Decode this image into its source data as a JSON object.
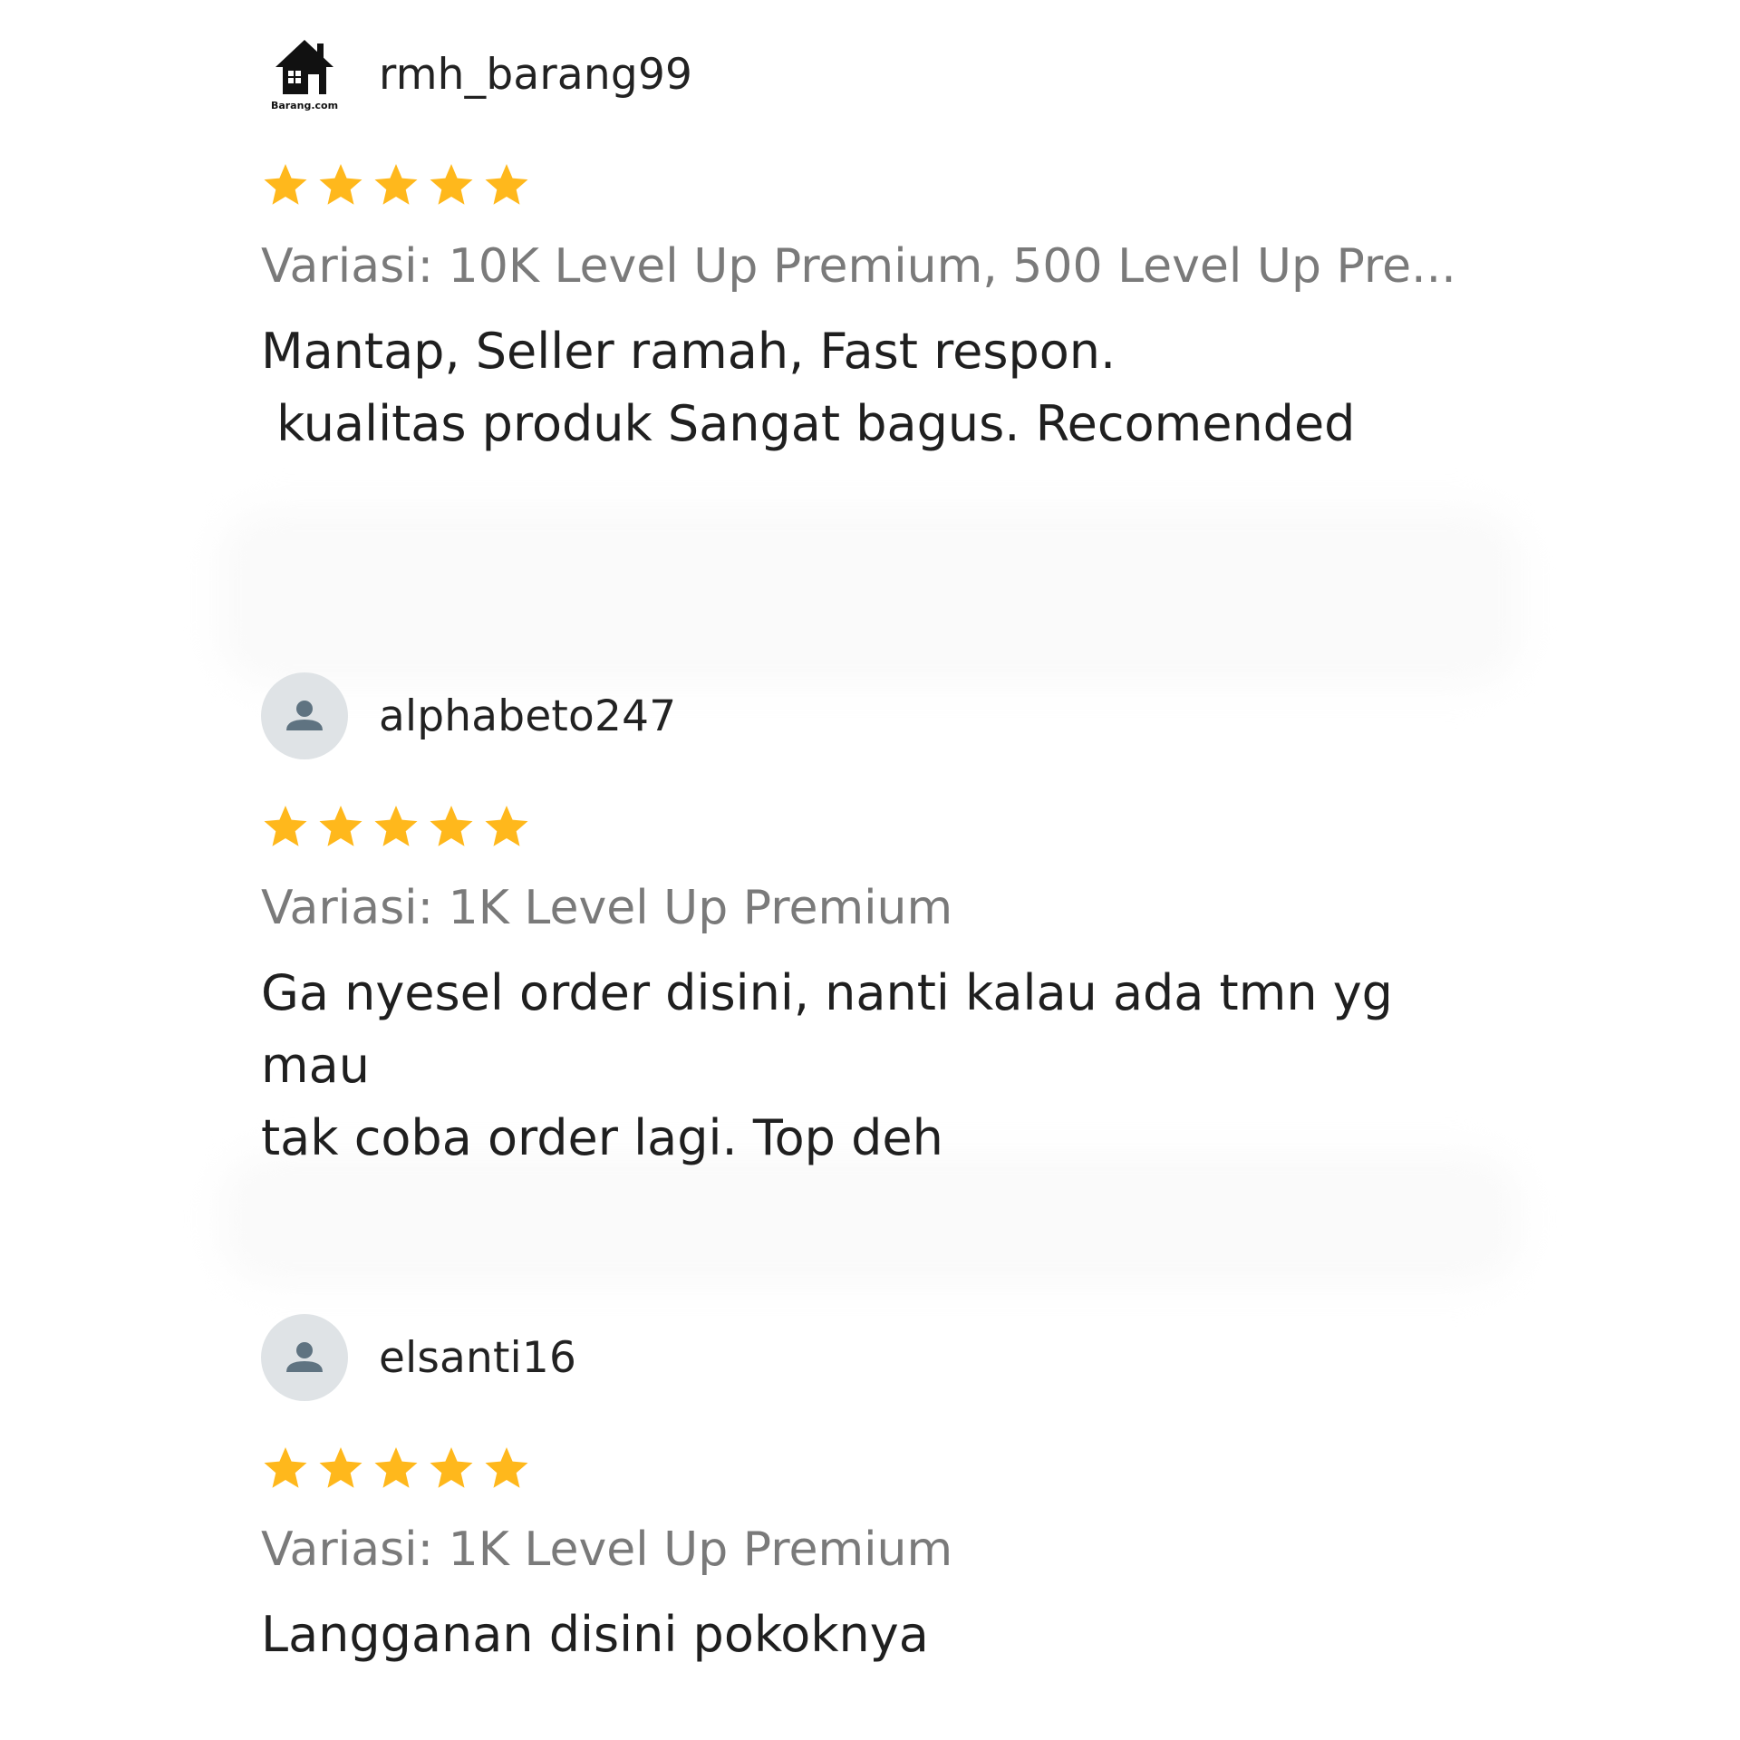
{
  "colors": {
    "star": "#FFB81C",
    "variation_text": "#7a7a7a",
    "avatar_bg": "#dfe3e6",
    "avatar_icon": "#5f7381"
  },
  "reviews": [
    {
      "username": "rmh_barang99",
      "avatar_icon": "house-logo-icon",
      "avatar_logo_text": "Barang.com",
      "rating": 5,
      "variation": "Variasi: 10K Level Up Premium, 500 Level Up Pre...",
      "comment": "Mantap, Seller ramah, Fast respon.\n kualitas produk Sangat bagus. Recomended"
    },
    {
      "username": "alphabeto247",
      "avatar_icon": "user-icon",
      "rating": 5,
      "variation": "Variasi: 1K Level Up Premium",
      "comment": "Ga nyesel order disini, nanti kalau ada tmn yg mau\ntak coba order lagi. Top deh"
    },
    {
      "username": "elsanti16",
      "avatar_icon": "user-icon",
      "rating": 5,
      "variation": "Variasi: 1K Level Up Premium",
      "comment": "Langganan disini pokoknya"
    }
  ]
}
